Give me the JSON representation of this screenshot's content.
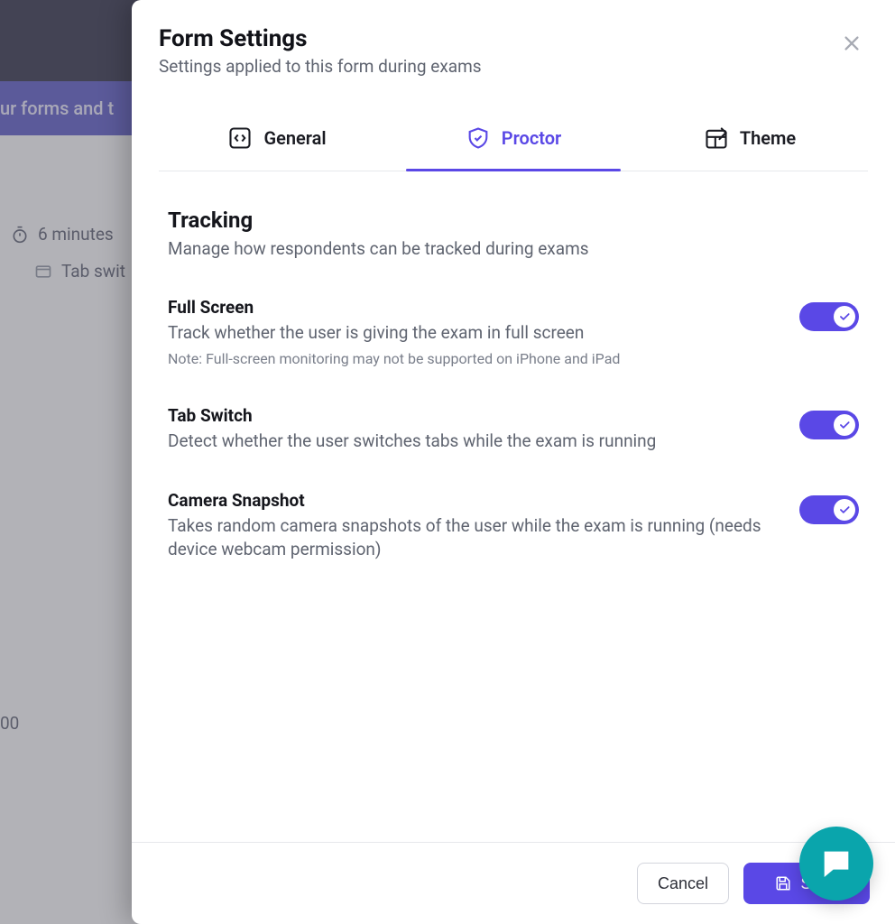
{
  "background": {
    "banner_text": "ur forms and t",
    "time_label": "6 minutes",
    "tab_switch_label": "Tab swit",
    "bottom_value": "00"
  },
  "modal": {
    "title": "Form Settings",
    "subtitle": "Settings applied to this form during exams",
    "tabs": {
      "general": "General",
      "proctor": "Proctor",
      "theme": "Theme"
    },
    "section": {
      "title": "Tracking",
      "subtitle": "Manage how respondents can be tracked during exams"
    },
    "items": {
      "full_screen": {
        "title": "Full Screen",
        "desc": "Track whether the user is giving the exam in full screen",
        "note": "Note: Full-screen monitoring may not be supported on iPhone and iPad"
      },
      "tab_switch": {
        "title": "Tab Switch",
        "desc": "Detect whether the user switches tabs while the exam is running"
      },
      "camera": {
        "title": "Camera Snapshot",
        "desc": "Takes random camera snapshots of the user while the exam is running (needs device webcam permission)"
      }
    },
    "footer": {
      "cancel": "Cancel",
      "save": "Save"
    }
  }
}
